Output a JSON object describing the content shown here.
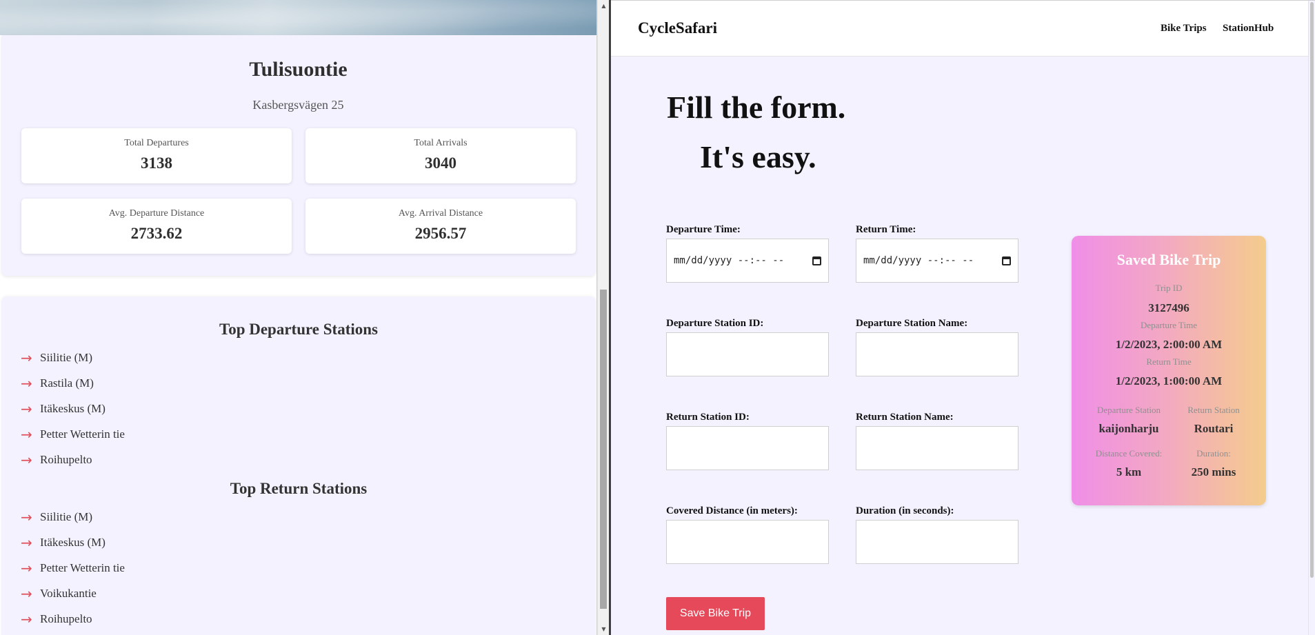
{
  "station": {
    "name": "Tulisuontie",
    "address": "Kasbergsvägen 25",
    "stats": [
      {
        "label": "Total Departures",
        "value": "3138"
      },
      {
        "label": "Total Arrivals",
        "value": "3040"
      },
      {
        "label": "Avg. Departure Distance",
        "value": "2733.62"
      },
      {
        "label": "Avg. Arrival Distance",
        "value": "2956.57"
      }
    ]
  },
  "top_departure": {
    "heading": "Top Departure Stations",
    "items": [
      "Siilitie (M)",
      "Rastila (M)",
      "Itäkeskus (M)",
      "Petter Wetterin tie",
      "Roihupelto"
    ]
  },
  "top_return": {
    "heading": "Top Return Stations",
    "items": [
      "Siilitie (M)",
      "Itäkeskus (M)",
      "Petter Wetterin tie",
      "Voikukantie",
      "Roihupelto"
    ]
  },
  "icons": {
    "arrow": "→",
    "arrow_icon_name": "arrow-right-icon",
    "calendar_icon_name": "calendar-icon"
  },
  "nav": {
    "brand": "CycleSafari",
    "links": [
      "Bike Trips",
      "StationHub"
    ]
  },
  "hero": {
    "line1": "Fill the form.",
    "line2": "It's easy."
  },
  "form": {
    "departure_time": {
      "label": "Departure Time:",
      "placeholder": "mm/dd/yyyy --:-- --"
    },
    "return_time": {
      "label": "Return Time:",
      "placeholder": "mm/dd/yyyy --:-- --"
    },
    "departure_station_id": {
      "label": "Departure Station ID:",
      "value": ""
    },
    "departure_station_name": {
      "label": "Departure Station Name:",
      "value": ""
    },
    "return_station_id": {
      "label": "Return Station ID:",
      "value": ""
    },
    "return_station_name": {
      "label": "Return Station Name:",
      "value": ""
    },
    "covered_distance": {
      "label": "Covered Distance (in meters):",
      "value": ""
    },
    "duration": {
      "label": "Duration (in seconds):",
      "value": ""
    },
    "submit_label": "Save Bike Trip"
  },
  "saved_trip": {
    "title": "Saved Bike Trip",
    "trip_id_label": "Trip ID",
    "trip_id": "3127496",
    "departure_time_label": "Departure Time",
    "departure_time": "1/2/2023, 2:00:00 AM",
    "return_time_label": "Return Time",
    "return_time": "1/2/2023, 1:00:00 AM",
    "departure_station_label": "Departure Station",
    "departure_station": "kaijonharju",
    "return_station_label": "Return Station",
    "return_station": "Routari",
    "distance_label": "Distance Covered:",
    "distance": "5 km",
    "duration_label": "Duration:",
    "duration": "250 mins"
  },
  "colors": {
    "page_bg": "#f4f2fe",
    "accent_button": "#e6495a",
    "arrow": "#e0505c",
    "card_gradient_start": "#f08ee8",
    "card_gradient_end": "#f4cc8c"
  }
}
